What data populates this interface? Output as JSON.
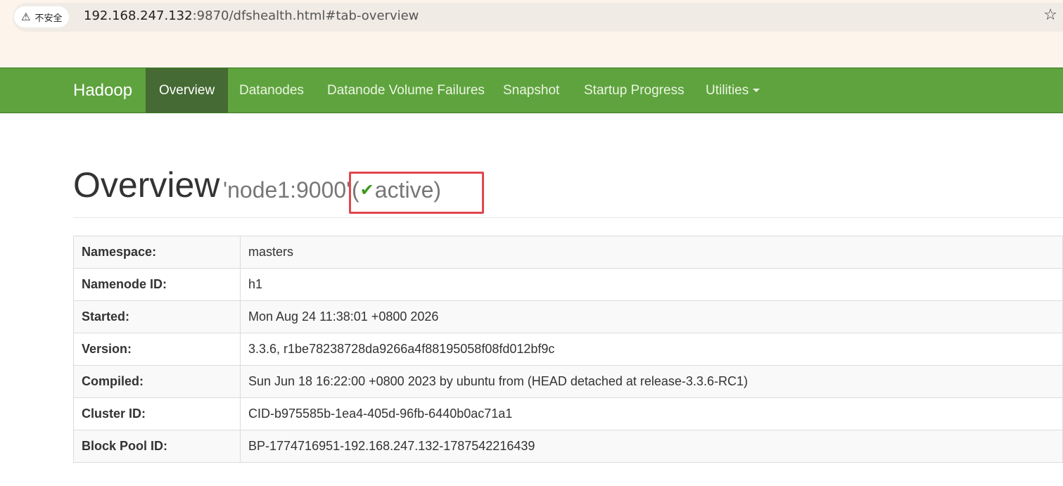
{
  "browser": {
    "security_label": "不安全",
    "url_host": "192.168.247.132",
    "url_rest": ":9870/dfshealth.html#tab-overview",
    "warning_icon": "warning-triangle-icon",
    "star_icon": "bookmark-star-icon"
  },
  "navbar": {
    "brand": "Hadoop",
    "items": [
      {
        "label": "Overview",
        "active": true
      },
      {
        "label": "Datanodes",
        "active": false
      },
      {
        "label": "Datanode Volume Failures",
        "active": false
      },
      {
        "label": "Snapshot",
        "active": false
      },
      {
        "label": "Startup Progress",
        "active": false
      },
      {
        "label": "Utilities",
        "active": false,
        "dropdown": true
      }
    ],
    "bg_color": "#5fa33e",
    "active_color": "#456a33"
  },
  "header": {
    "title": "Overview",
    "host": "'node1:9000'",
    "status_open": "(",
    "status_text": "active",
    "status_close": ")",
    "status_icon": "check-icon",
    "highlight_color": "#e0474c"
  },
  "overview": {
    "rows": [
      {
        "key": "Namespace:",
        "value": "masters"
      },
      {
        "key": "Namenode ID:",
        "value": "h1"
      },
      {
        "key": "Started:",
        "value": "Mon Aug 24 11:38:01 +0800 2026"
      },
      {
        "key": "Version:",
        "value": "3.3.6, r1be78238728da9266a4f88195058f08fd012bf9c"
      },
      {
        "key": "Compiled:",
        "value": "Sun Jun 18 16:22:00 +0800 2023 by ubuntu from (HEAD detached at release-3.3.6-RC1)"
      },
      {
        "key": "Cluster ID:",
        "value": "CID-b975585b-1ea4-405d-96fb-6440b0ac71a1"
      },
      {
        "key": "Block Pool ID:",
        "value": "BP-1774716951-192.168.247.132-1787542216439"
      }
    ]
  }
}
